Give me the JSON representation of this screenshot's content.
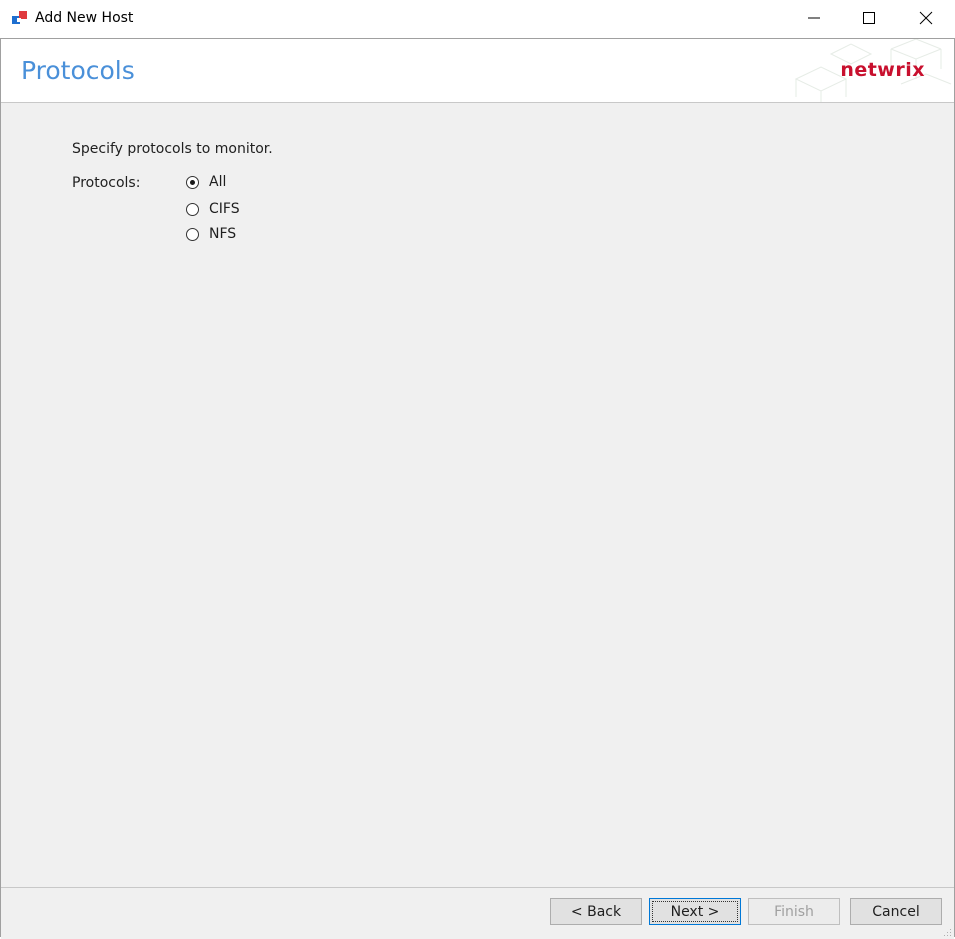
{
  "window": {
    "title": "Add New Host",
    "controls": [
      "minimize-icon",
      "maximize-icon",
      "close-icon"
    ]
  },
  "header": {
    "title": "Protocols",
    "logo_text": "netwrix"
  },
  "content": {
    "instruction": "Specify protocols to monitor.",
    "protocols_label": "Protocols:",
    "options": [
      {
        "label": "All",
        "selected": true
      },
      {
        "label": "CIFS",
        "selected": false
      },
      {
        "label": "NFS",
        "selected": false
      }
    ]
  },
  "footer": {
    "back": "< Back",
    "next": "Next >",
    "finish": "Finish",
    "cancel": "Cancel"
  },
  "colors": {
    "title_blue": "#4a90d9",
    "logo_red": "#c8102e",
    "panel_bg": "#f0f0f0"
  }
}
